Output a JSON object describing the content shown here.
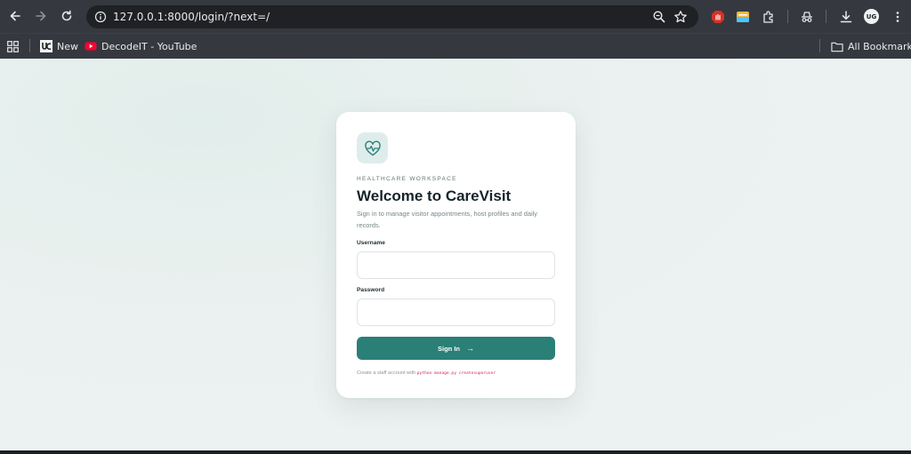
{
  "browser": {
    "url": "127.0.0.1:8000/login/?next=/",
    "profile_initials": "UG"
  },
  "bookmarks": {
    "items": [
      {
        "label": "New",
        "icon": "uc-logo-icon"
      },
      {
        "label": "DecodeIT - YouTube",
        "icon": "youtube-icon"
      }
    ],
    "all_bookmarks": "All Bookmarks"
  },
  "login": {
    "eyebrow": "HEALTHCARE WORKSPACE",
    "title": "Welcome to CareVisit",
    "subtitle": "Sign in to manage visitor appointments, host profiles and daily records.",
    "username_label": "Username",
    "username_value": "",
    "password_label": "Password",
    "password_value": "",
    "signin_label": "Sign In",
    "signin_arrow": "→",
    "hint_text": "Create a staff account with",
    "hint_command": "python manage.py createsuperuser"
  },
  "colors": {
    "accent": "#2a7f77",
    "chrome": "#35393f",
    "command": "#d21f63"
  }
}
